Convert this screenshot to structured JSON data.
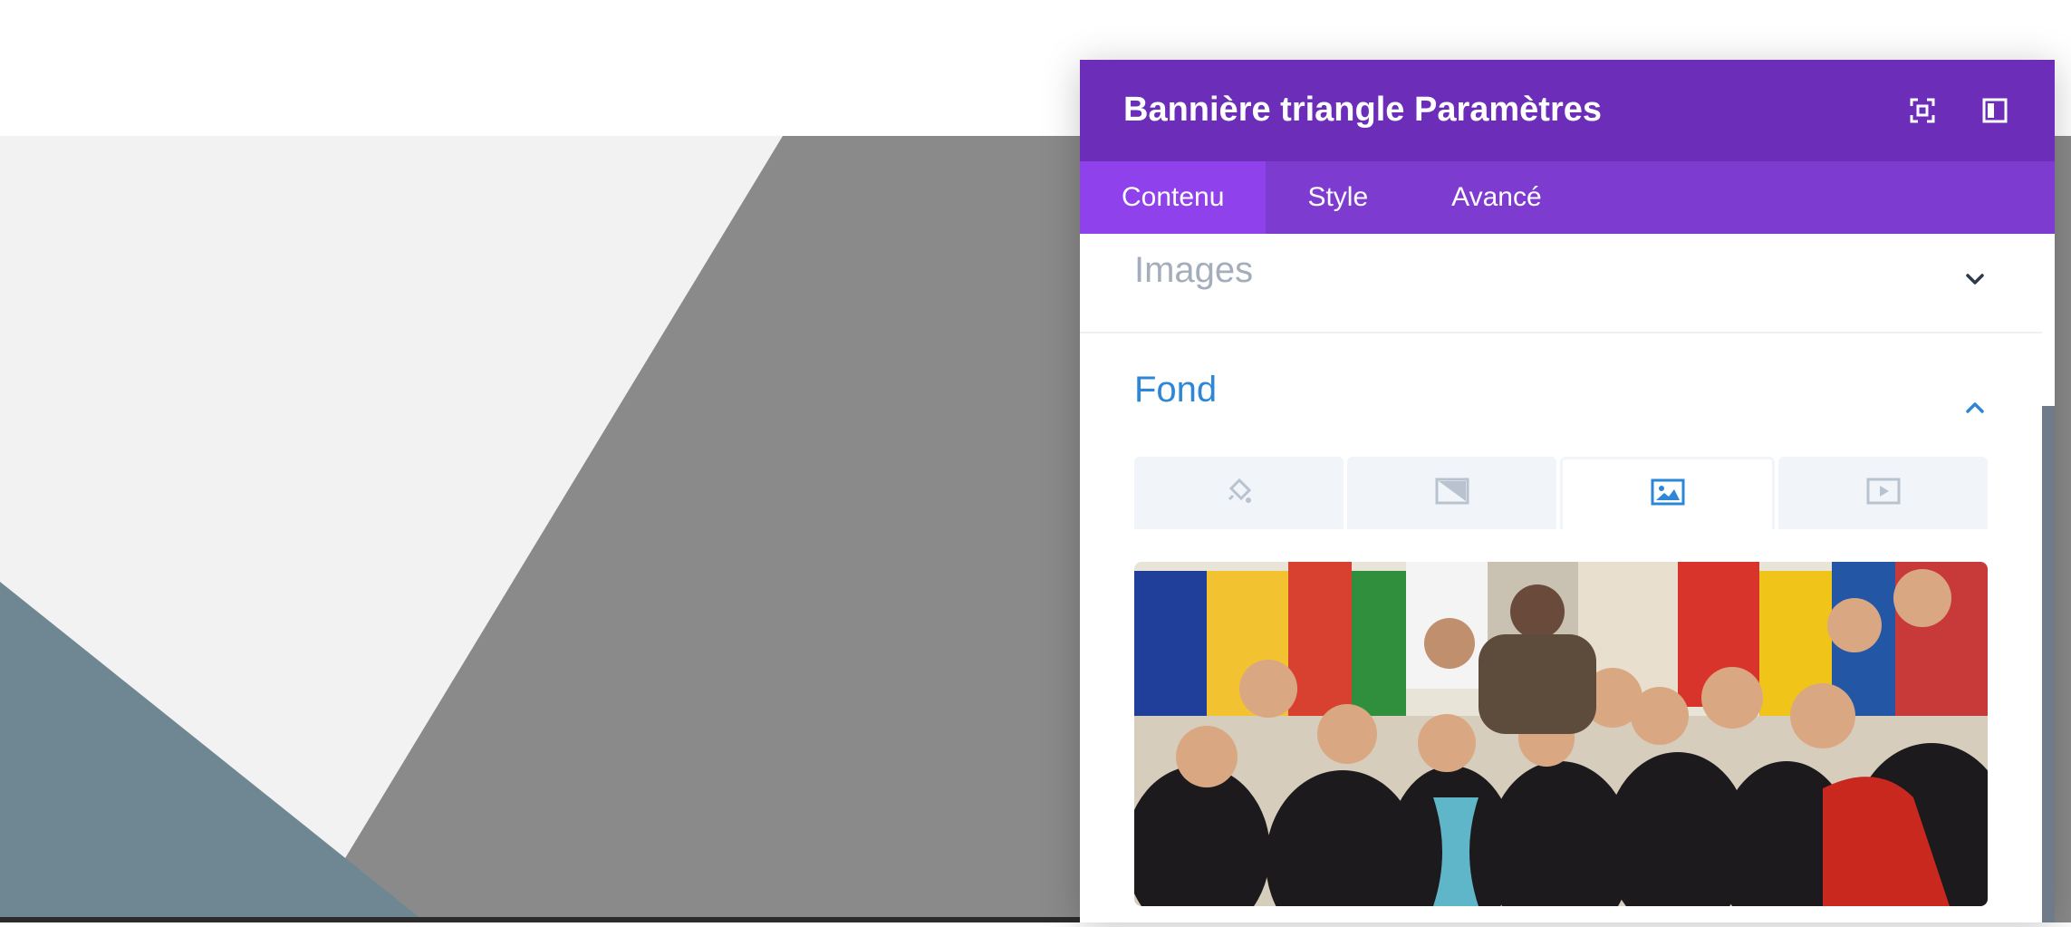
{
  "modal": {
    "title": "Bannière triangle Paramètres",
    "header_icons": [
      "fullscreen-icon",
      "sidebar-dock-icon"
    ],
    "tabs": [
      {
        "label": "Contenu",
        "active": true
      },
      {
        "label": "Style",
        "active": false
      },
      {
        "label": "Avancé",
        "active": false
      }
    ]
  },
  "sections": {
    "images": {
      "title": "Images",
      "expanded": false
    },
    "fond": {
      "title": "Fond",
      "expanded": true,
      "background_types": [
        {
          "icon": "paint-bucket-icon",
          "active": false
        },
        {
          "icon": "gradient-icon",
          "active": false
        },
        {
          "icon": "image-icon",
          "active": true
        },
        {
          "icon": "video-icon",
          "active": false
        }
      ]
    }
  },
  "colors": {
    "header": "#6c2eb9",
    "tabs_bar": "#7e3bd0",
    "active_tab": "#8f42ec",
    "accent_blue": "#2e87d6",
    "muted_title": "#a4adbb",
    "canvas_light": "#f2f2f2",
    "canvas_gray": "#8a8a8a",
    "canvas_slate": "#6f8793"
  }
}
